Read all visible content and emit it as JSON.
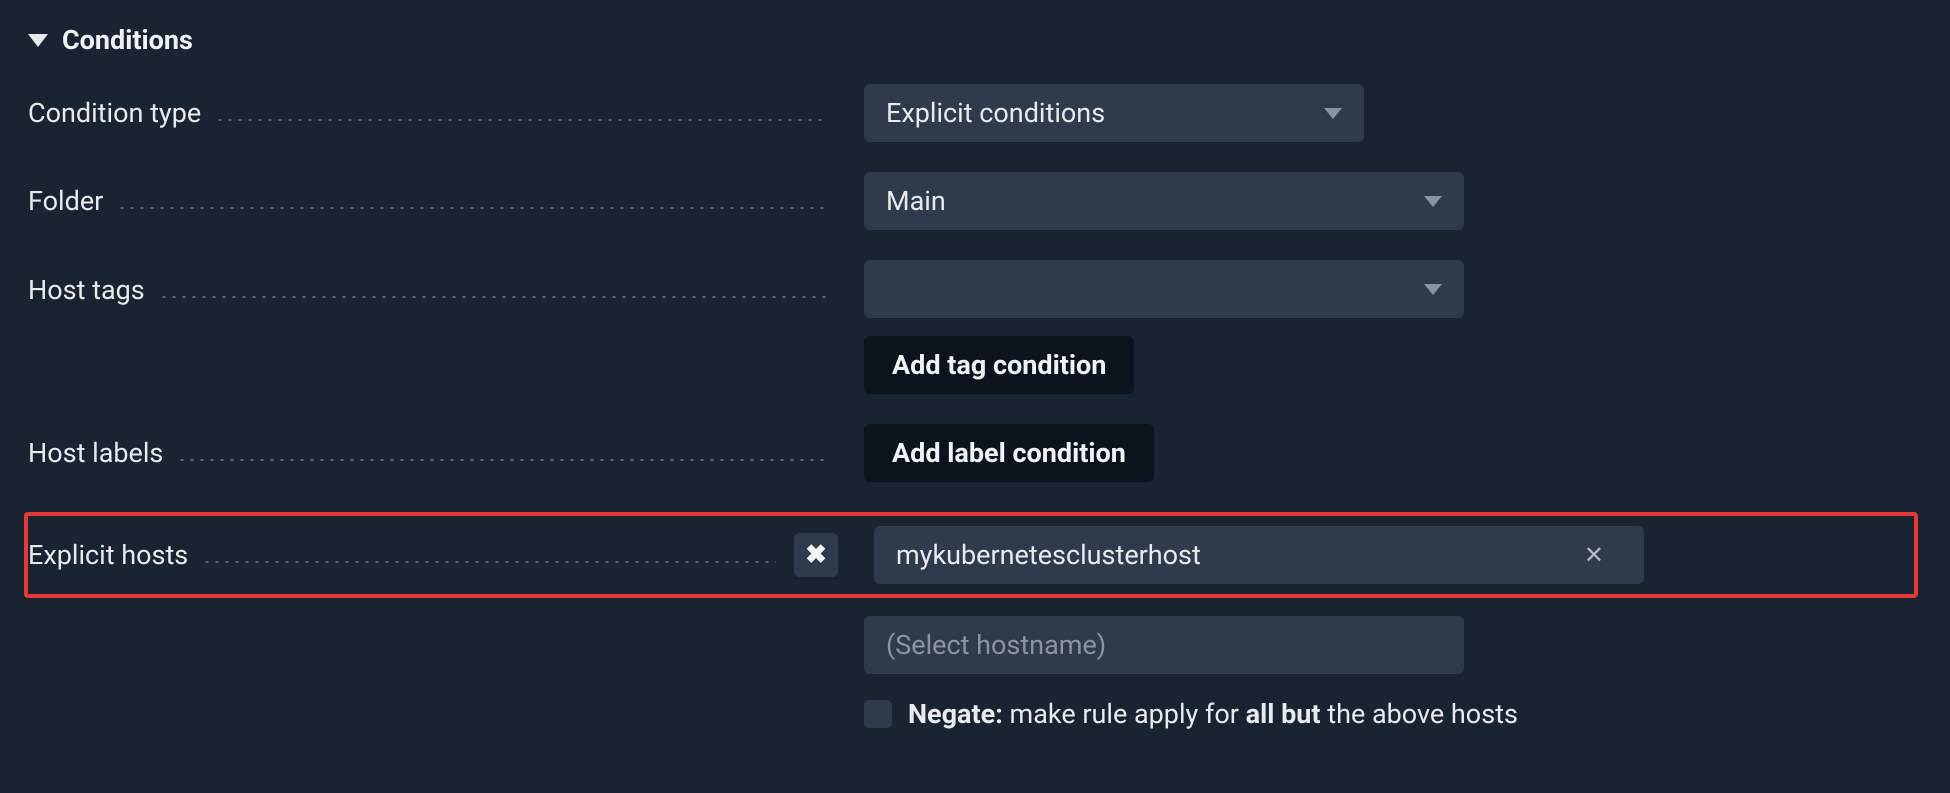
{
  "section": {
    "title": "Conditions"
  },
  "rows": {
    "condition_type": {
      "label": "Condition type",
      "value": "Explicit conditions"
    },
    "folder": {
      "label": "Folder",
      "value": "Main"
    },
    "host_tags": {
      "label": "Host tags",
      "value": "",
      "add_button": "Add tag condition"
    },
    "host_labels": {
      "label": "Host labels",
      "add_button": "Add label condition"
    },
    "explicit_hosts": {
      "label": "Explicit hosts",
      "selected_host": "mykubernetesclusterhost",
      "placeholder": "(Select hostname)",
      "negate_label": "Negate:",
      "negate_text_prefix": " make rule apply for ",
      "negate_text_bold": "all but",
      "negate_text_suffix": " the above hosts"
    }
  }
}
